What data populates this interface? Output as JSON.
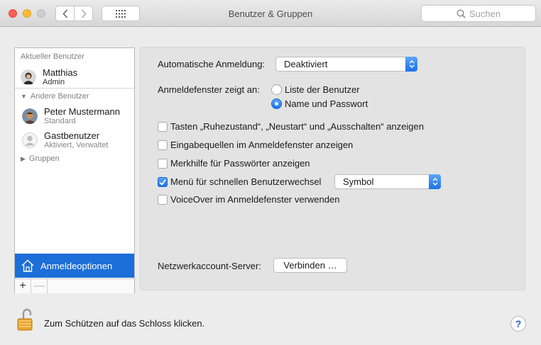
{
  "window": {
    "title": "Benutzer & Gruppen",
    "search_placeholder": "Suchen"
  },
  "sidebar": {
    "current_header": "Aktueller Benutzer",
    "current_user": {
      "name": "Matthias",
      "role": "Admin"
    },
    "other_header": "Andere Benutzer",
    "other_users": [
      {
        "name": "Peter Mustermann",
        "role": "Standard"
      },
      {
        "name": "Gastbenutzer",
        "role": "Aktiviert, Verwaltet"
      }
    ],
    "groups_label": "Gruppen",
    "login_options_label": "Anmeldeoptionen",
    "add_label": "+",
    "remove_label": "—"
  },
  "main": {
    "auto_login_label": "Automatische Anmeldung:",
    "auto_login_value": "Deaktiviert",
    "login_window_label": "Anmeldefenster zeigt an:",
    "radio_options": [
      {
        "label": "Liste der Benutzer",
        "selected": false
      },
      {
        "label": "Name und Passwort",
        "selected": true
      }
    ],
    "checkboxes": [
      {
        "label": "Tasten „Ruhezustand“, „Neustart“ und „Ausschalten“ anzeigen",
        "checked": false
      },
      {
        "label": "Eingabequellen im Anmeldefenster anzeigen",
        "checked": false
      },
      {
        "label": "Merkhilfe für Passwörter anzeigen",
        "checked": false
      },
      {
        "label": "Menü für schnellen Benutzerwechsel",
        "checked": true
      },
      {
        "label": "VoiceOver im Anmeldefenster verwenden",
        "checked": false
      }
    ],
    "fast_switch_value": "Symbol",
    "network_server_label": "Netzwerkaccount-Server:",
    "connect_button": "Verbinden …"
  },
  "footer": {
    "lock_text": "Zum Schützen auf das Schloss klicken.",
    "help_label": "?"
  },
  "colors": {
    "accent": "#1c6ed8",
    "close": "#fd5f57",
    "minimize": "#febb2e"
  }
}
